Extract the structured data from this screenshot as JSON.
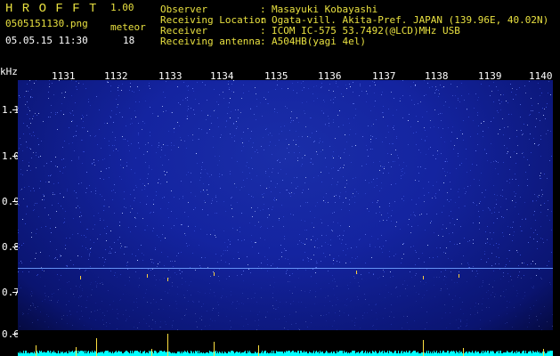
{
  "header": {
    "app_title": "H R O F F T",
    "version": "1.00",
    "filename": "0505151130.png",
    "meteor_label": "meteor",
    "datetime": "05.05.15 11:30",
    "meteor_count": "18"
  },
  "info": [
    {
      "label": "Observer",
      "value": "Masayuki Kobayashi"
    },
    {
      "label": "Receiving Location",
      "value": "Ogata-vill. Akita-Pref. JAPAN (139.96E, 40.02N)"
    },
    {
      "label": "Receiver",
      "value": "ICOM IC-575 53.7492(@LCD)MHz USB"
    },
    {
      "label": "Receiving antenna",
      "value": "A504HB(yagi 4el)"
    }
  ],
  "axis": {
    "y_unit": "kHz",
    "y_ticks": [
      "1.1",
      "1.0",
      "0.9",
      "0.8",
      "0.7",
      "0.6"
    ],
    "x_ticks": [
      "1131",
      "1132",
      "1133",
      "1134",
      "1135",
      "1136",
      "1137",
      "1138",
      "1139",
      "1140"
    ]
  },
  "colors": {
    "label": "#e8e040",
    "background": "#000000",
    "spectrogram": "#1424a0",
    "signal": "#00ffff"
  }
}
